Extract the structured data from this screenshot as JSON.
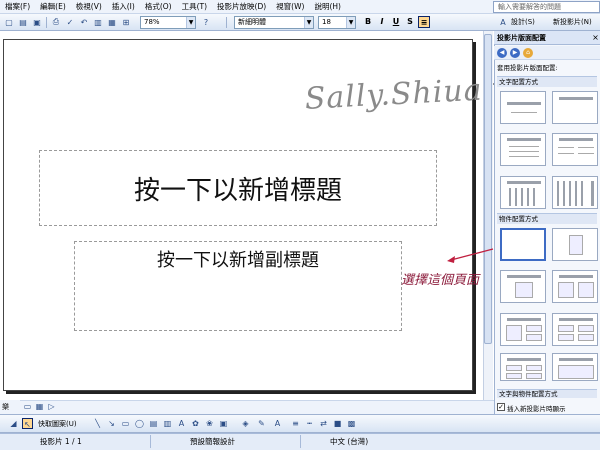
{
  "menu": {
    "items": [
      "檔案(F)",
      "編輯(E)",
      "檢視(V)",
      "插入(I)",
      "格式(O)",
      "工具(T)",
      "投影片放映(D)",
      "視窗(W)",
      "說明(H)"
    ]
  },
  "help": {
    "placeholder": "輸入需要解答的問題"
  },
  "toolbar": {
    "zoom": "78%",
    "font_name": "新細明體",
    "font_size": "18",
    "bold": "B",
    "italic": "I",
    "underline": "U",
    "shadow": "S",
    "design_label": "設計(S)",
    "new_slide_label": "新投影片(N)"
  },
  "slide": {
    "title_placeholder": "按一下以新增標題",
    "subtitle_placeholder": "按一下以新增副標題",
    "watermark": "Sally.Shiuan"
  },
  "annotation": {
    "text": "選擇這個頁面"
  },
  "taskpane": {
    "title": "投影片版面配置",
    "close": "×",
    "apply_label": "套用投影片版面配置:",
    "section_text": "文字配置方式",
    "section_content": "物件配置方式",
    "section_text_content": "文字與物件配置方式",
    "checkbox_label": "插入新投影片時顯示",
    "checkbox_checked": "✓"
  },
  "drawbar": {
    "view_label": "樂",
    "autoshapes": "快取圖案(U)"
  },
  "status": {
    "slide_count": "投影片 1 / 1",
    "design": "預設簡報設計",
    "language": "中文 (台灣)"
  }
}
